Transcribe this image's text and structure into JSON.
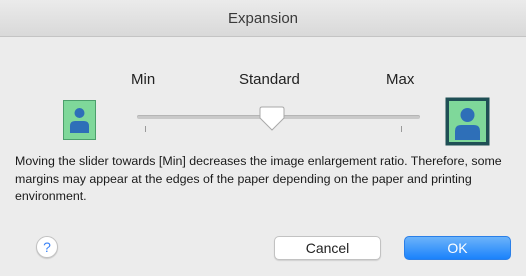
{
  "window": {
    "title": "Expansion"
  },
  "slider": {
    "min_label": "Min",
    "standard_label": "Standard",
    "max_label": "Max",
    "position": "Standard"
  },
  "description": "Moving the slider towards [Min] decreases the image enlargement ratio. Therefore, some margins may appear at the edges of the paper depending on the paper and printing environment.",
  "buttons": {
    "help": "?",
    "cancel": "Cancel",
    "ok": "OK"
  },
  "colors": {
    "accent": "#1a82fb",
    "icon_background": "#7fd89a",
    "icon_figure": "#2e6fb8"
  }
}
